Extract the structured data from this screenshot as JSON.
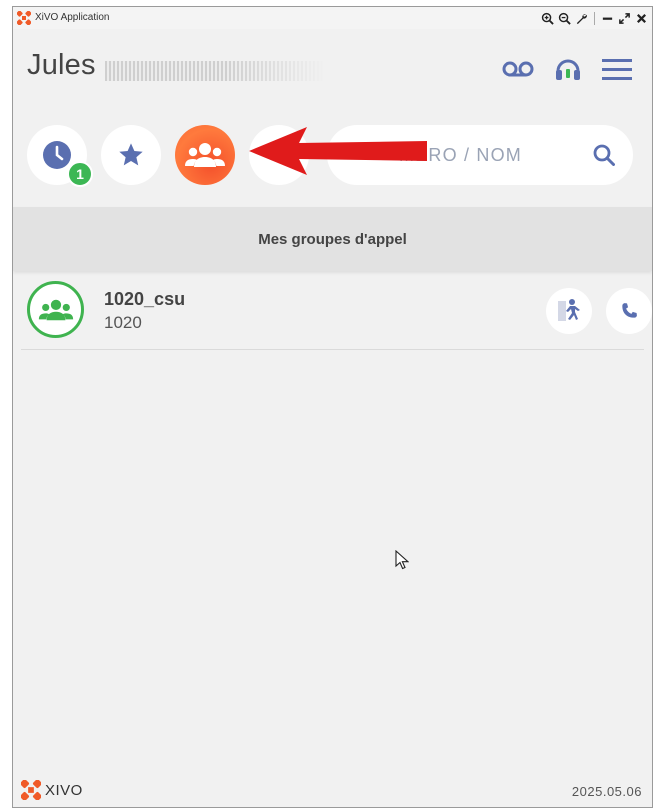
{
  "window": {
    "title": "XiVO Application"
  },
  "header": {
    "user_name": "Jules"
  },
  "quickbar": {
    "history_badge": "1",
    "search_placeholder": "MÉRO / NOM"
  },
  "section": {
    "title": "Mes groupes d'appel"
  },
  "groups": [
    {
      "name": "1020_csu",
      "number": "1020"
    }
  ],
  "footer": {
    "logo_text": "XIVO",
    "version": "2025.05.06"
  },
  "colors": {
    "accent_orange": "#f05a28",
    "badge_green": "#3cb754",
    "group_green": "#3fb34f",
    "icon_blue": "#5a6fb0",
    "arrow_red": "#e01b1b"
  },
  "icons": {
    "app": "xivo-logo-icon",
    "zoom_in": "zoom-in-icon",
    "zoom_out": "zoom-out-icon",
    "settings": "wrench-icon",
    "minimize": "minimize-icon",
    "maximize": "expand-icon",
    "close": "close-icon",
    "voicemail": "voicemail-icon",
    "headset": "headset-icon",
    "menu": "hamburger-menu-icon",
    "history": "clock-icon",
    "favorites": "star-icon",
    "groups": "group-icon",
    "search": "search-icon",
    "leave_group": "exit-person-icon",
    "call": "phone-icon"
  }
}
